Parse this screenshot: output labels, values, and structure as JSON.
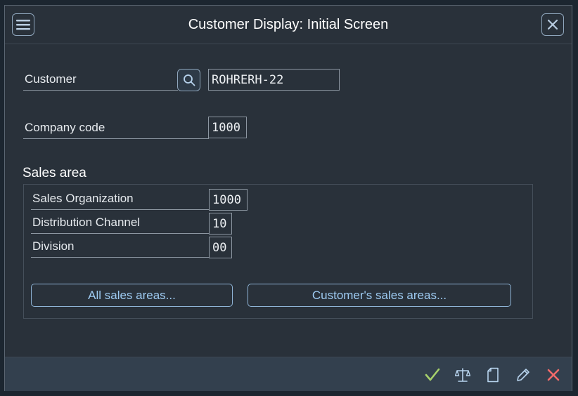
{
  "title": "Customer Display: Initial Screen",
  "icons": {
    "menu": "hamburger-menu-icon",
    "close": "close-icon",
    "search": "search-icon",
    "footer": [
      "checkmark-icon",
      "balance-scale-icon",
      "document-icon",
      "pencil-icon",
      "red-x-icon"
    ]
  },
  "colors": {
    "background": "#29313a",
    "footer": "#33404e",
    "accent": "#9ecbf2",
    "confirm": "#a6d06b",
    "cancel": "#f06a6a"
  },
  "form": {
    "customer": {
      "label": "Customer",
      "value": "ROHRERH-22"
    },
    "company_code": {
      "label": "Company code",
      "value": "1000"
    }
  },
  "sales_area": {
    "title": "Sales area",
    "sales_org": {
      "label": "Sales Organization",
      "value": "1000"
    },
    "dist_channel": {
      "label": "Distribution Channel",
      "value": "10"
    },
    "division": {
      "label": "Division",
      "value": "00"
    },
    "all_btn": "All sales areas...",
    "customer_btn": "Customer's sales areas..."
  }
}
